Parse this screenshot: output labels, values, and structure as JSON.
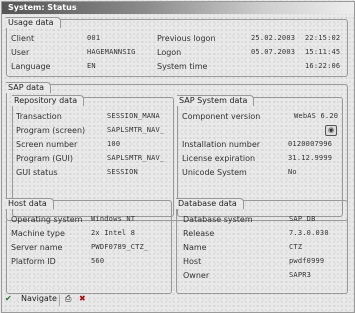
{
  "window": {
    "title": "System: Status"
  },
  "usage": {
    "title": "Usage data",
    "client_label": "Client",
    "client_value": "001",
    "user_label": "User",
    "user_value": "HAGEMANNSIG",
    "language_label": "Language",
    "language_value": "EN",
    "prev_logon_label": "Previous logon",
    "prev_logon_date": "25.02.2003",
    "prev_logon_time": "22:15:02",
    "logon_label": "Logon",
    "logon_date": "05.07.2003",
    "logon_time": "15:11:45",
    "system_time_label": "System time",
    "system_time_value": "16:22:06"
  },
  "sap_data": {
    "title": "SAP data",
    "repository": {
      "title": "Repository data",
      "transaction_label": "Transaction",
      "transaction_value": "SESSION_MANA",
      "program_screen_label": "Program (screen)",
      "program_screen_value": "SAPLSMTR_NAV_",
      "screen_number_label": "Screen number",
      "screen_number_value": "100",
      "program_gui_label": "Program (GUI)",
      "program_gui_value": "SAPLSMTR_NAV_",
      "gui_status_label": "GUI status",
      "gui_status_value": "SESSION"
    },
    "system": {
      "title": "SAP System data",
      "component_label": "Component version",
      "component_value": "WebAS 6.20",
      "installation_label": "Installation number",
      "installation_value": "0120007996",
      "license_label": "License expiration",
      "license_value": "31.12.9999",
      "unicode_label": "Unicode System",
      "unicode_value": "No"
    }
  },
  "host": {
    "title": "Host data",
    "os_label": "Operating system",
    "os_value": "Windows NT",
    "machine_label": "Machine type",
    "machine_value": "2x Intel 8",
    "server_label": "Server name",
    "server_value": "PWDF0789_CTZ_",
    "platform_label": "Platform ID",
    "platform_value": "560"
  },
  "database": {
    "title": "Database data",
    "system_label": "Database system",
    "system_value": "SAP DB",
    "release_label": "Release",
    "release_value": "7.3.0.030",
    "name_label": "Name",
    "name_value": "CTZ",
    "host_label": "Host",
    "host_value": "pwdf0999",
    "owner_label": "Owner",
    "owner_value": "SAPR3"
  },
  "toolbar": {
    "navigate_label": "Navigate"
  }
}
